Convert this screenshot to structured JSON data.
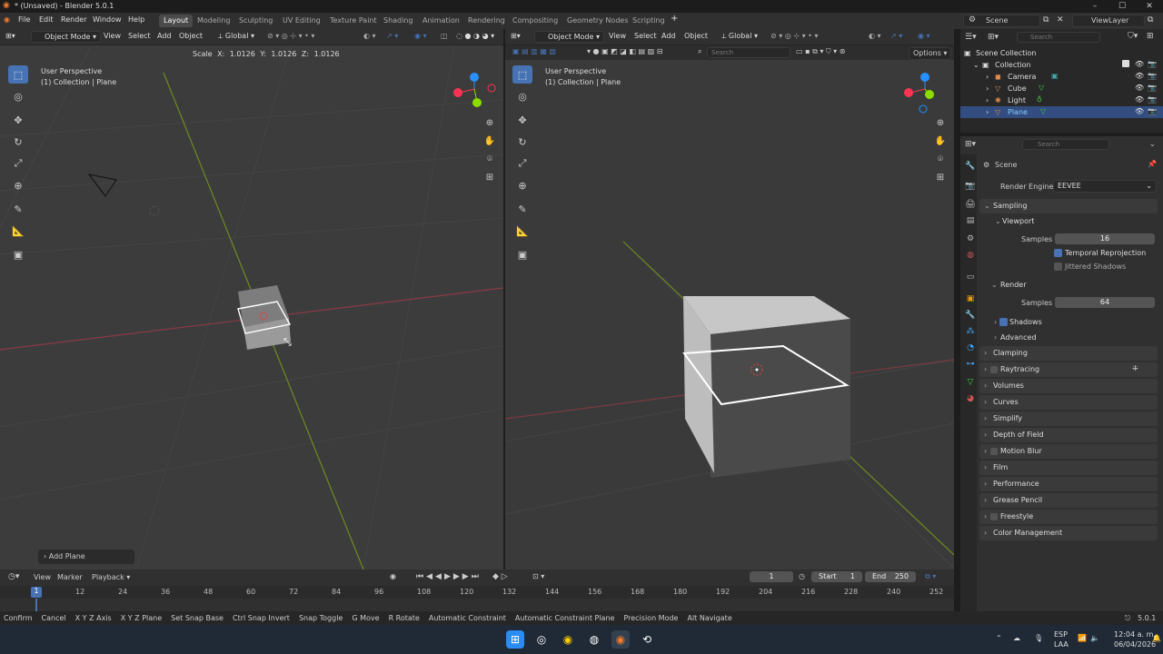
{
  "window": {
    "title": "* (Unsaved) - Blender 5.0.1"
  },
  "menus": [
    "File",
    "Edit",
    "Render",
    "Window",
    "Help"
  ],
  "workspaces": [
    "Layout",
    "Modeling",
    "Sculpting",
    "UV Editing",
    "Texture Paint",
    "Shading",
    "Animation",
    "Rendering",
    "Compositing",
    "Geometry Nodes",
    "Scripting"
  ],
  "scene": "Scene",
  "view_layer": "ViewLayer",
  "left_vp": {
    "mode": "Object Mode",
    "menus": [
      "View",
      "Select",
      "Add",
      "Object"
    ],
    "orientation": "Global",
    "op_readout": "Scale X: 1.0126   Y: 1.0126   Z: 1.0126",
    "persp": "User Perspective",
    "coll": "(1) Collection | Plane",
    "last_op": "Add Plane"
  },
  "right_vp": {
    "mode": "Object Mode",
    "menus": [
      "View",
      "Select",
      "Add",
      "Object"
    ],
    "orientation": "Global",
    "search_ph": "Search",
    "options": "Options",
    "persp": "User Perspective",
    "coll": "(1) Collection | Plane"
  },
  "outliner": {
    "search_ph": "Search",
    "root": "Scene Collection",
    "collection": "Collection",
    "items": [
      "Camera",
      "Cube",
      "Light",
      "Plane"
    ],
    "selected": "Plane"
  },
  "props": {
    "search_ph": "Search",
    "context": "Scene",
    "engine_label": "Render Engine",
    "engine": "EEVEE",
    "sampling": "Sampling",
    "viewport": "Viewport",
    "samples_label": "Samples",
    "vp_samples": "16",
    "temporal": "Temporal Reprojection",
    "jittered": "Jittered Shadows",
    "render": "Render",
    "r_samples": "64",
    "shadows": "Shadows",
    "advanced": "Advanced",
    "panels": [
      "Clamping",
      "Raytracing",
      "Volumes",
      "Curves",
      "Simplify",
      "Depth of Field",
      "Motion Blur",
      "Film",
      "Performance",
      "Grease Pencil",
      "Freestyle",
      "Color Management"
    ]
  },
  "timeline": {
    "menus": [
      "View",
      "Marker",
      "Playback"
    ],
    "frame": "1",
    "start_label": "Start",
    "start": "1",
    "end_label": "End",
    "end": "250",
    "ticks": [
      "1",
      "12",
      "24",
      "36",
      "48",
      "60",
      "72",
      "84",
      "96",
      "108",
      "120",
      "132",
      "144",
      "156",
      "168",
      "180",
      "192",
      "204",
      "216",
      "228",
      "240",
      "252"
    ]
  },
  "status": {
    "items": [
      "Confirm",
      "Cancel",
      "X Y Z Axis",
      "X Y Z Plane",
      "Set Snap Base",
      "Ctrl Snap Invert",
      "Snap Toggle",
      "G Move",
      "R Rotate",
      "Automatic Constraint",
      "Automatic Constraint Plane",
      "Precision Mode",
      "Alt Navigate"
    ],
    "version": "5.0.1"
  },
  "tray": {
    "lang": "ESP",
    "lang2": "LAA",
    "time": "12:04 a. m.",
    "date": "06/04/2026"
  },
  "colors": {
    "accent": "#4772b3",
    "x": "#ff3352",
    "y": "#8bdc00",
    "z": "#2890ff"
  }
}
